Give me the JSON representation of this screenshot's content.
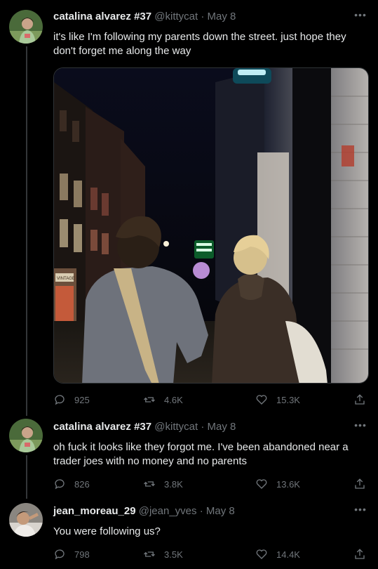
{
  "tweets": [
    {
      "name": "catalina alvarez #37",
      "handle": "@kittycat",
      "separator": "·",
      "date": "May 8",
      "text": "it's like I'm following my parents down the street. just hope they don't forget me along the way",
      "replies": "925",
      "retweets": "4.6K",
      "likes": "15.3K"
    },
    {
      "name": "catalina alvarez #37",
      "handle": "@kittycat",
      "separator": "·",
      "date": "May 8",
      "text": "oh fuck it looks like they forgot me. I've been abandoned near a trader joes with no money and no parents",
      "replies": "826",
      "retweets": "3.8K",
      "likes": "13.6K"
    },
    {
      "name": "jean_moreau_29",
      "handle": "@jean_yves",
      "separator": "·",
      "date": "May 8",
      "text": "You were following us?",
      "replies": "798",
      "retweets": "3.5K",
      "likes": "14.4K"
    }
  ],
  "colors": {
    "background": "#000000",
    "text": "#e7e9ea",
    "muted": "#71767b",
    "thread_line": "#333639"
  },
  "photo": {
    "storefront_sign": "VINTAGE"
  }
}
